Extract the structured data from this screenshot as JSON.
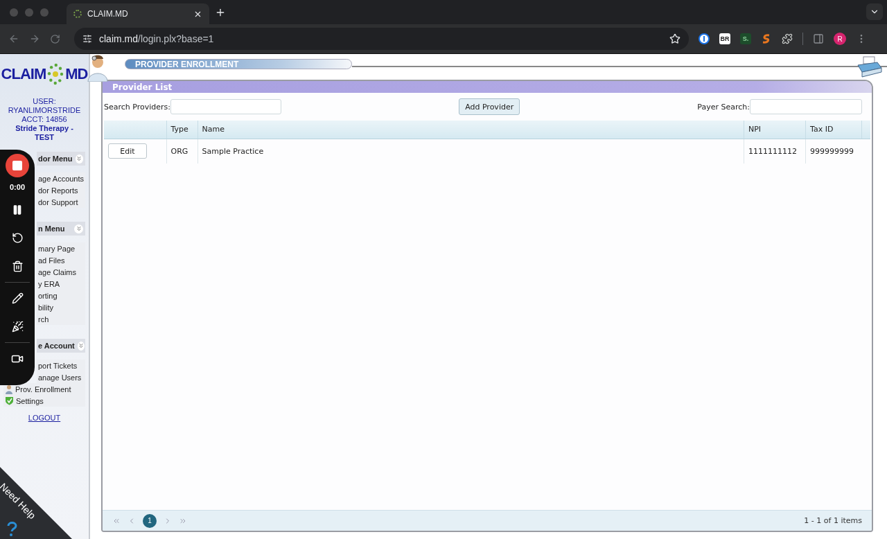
{
  "browser": {
    "tab_title": "CLAIM.MD",
    "url_host": "claim.md",
    "url_path": "/login.plx?base=1",
    "extensions": [
      {
        "kind": "password"
      },
      {
        "kind": "text",
        "label": "BR"
      },
      {
        "kind": "text",
        "label": "S."
      },
      {
        "kind": "swirl"
      },
      {
        "kind": "puzzle"
      }
    ],
    "avatar_letter": "R"
  },
  "recorder": {
    "timer": "0:00"
  },
  "sidebar": {
    "logo_left": "CLAIM",
    "logo_right": "MD",
    "user_lines": [
      "USER:",
      "RYANLIMORSTRIDE",
      "ACCT: 14856"
    ],
    "org": "Stride Therapy - TEST",
    "sections": [
      {
        "title": "dor Menu",
        "items": [
          {
            "label": "age Accounts",
            "kind": "cut"
          },
          {
            "label": "dor Reports",
            "kind": "cut"
          },
          {
            "label": "dor Support",
            "kind": "cut"
          }
        ]
      },
      {
        "title": "n Menu",
        "items": [
          {
            "label": "mary Page",
            "kind": "cut"
          },
          {
            "label": "ad Files",
            "kind": "cut"
          },
          {
            "label": "age Claims",
            "kind": "cut"
          },
          {
            "label": "y ERA",
            "kind": "cut"
          },
          {
            "label": "orting",
            "kind": "cut"
          },
          {
            "label": "bility",
            "kind": "cut"
          },
          {
            "label": "rch",
            "kind": "cut"
          }
        ]
      },
      {
        "title": "e Account",
        "items": [
          {
            "label": "port Tickets",
            "kind": "cut"
          },
          {
            "label": "anage Users",
            "kind": "cut"
          },
          {
            "label": "Prov. Enrollment",
            "kind": "person"
          },
          {
            "label": "Settings",
            "kind": "shield"
          }
        ]
      }
    ],
    "logout": "LOGOUT",
    "help": "Need Help"
  },
  "header": {
    "title": "PROVIDER ENROLLMENT"
  },
  "panel": {
    "title": "Provider List",
    "search_label": "Search Providers:",
    "add_button": "Add Provider",
    "payer_label": "Payer Search:",
    "table": {
      "columns": [
        "Type",
        "Name",
        "NPI",
        "Tax ID"
      ],
      "rows": [
        {
          "action": "Edit",
          "cells": [
            "ORG",
            "Sample Practice",
            "1111111112",
            "999999999"
          ]
        }
      ]
    },
    "pager": {
      "pages": [
        {
          "label": "1",
          "selected": true
        }
      ],
      "summary": "1 - 1 of 1 items"
    }
  }
}
